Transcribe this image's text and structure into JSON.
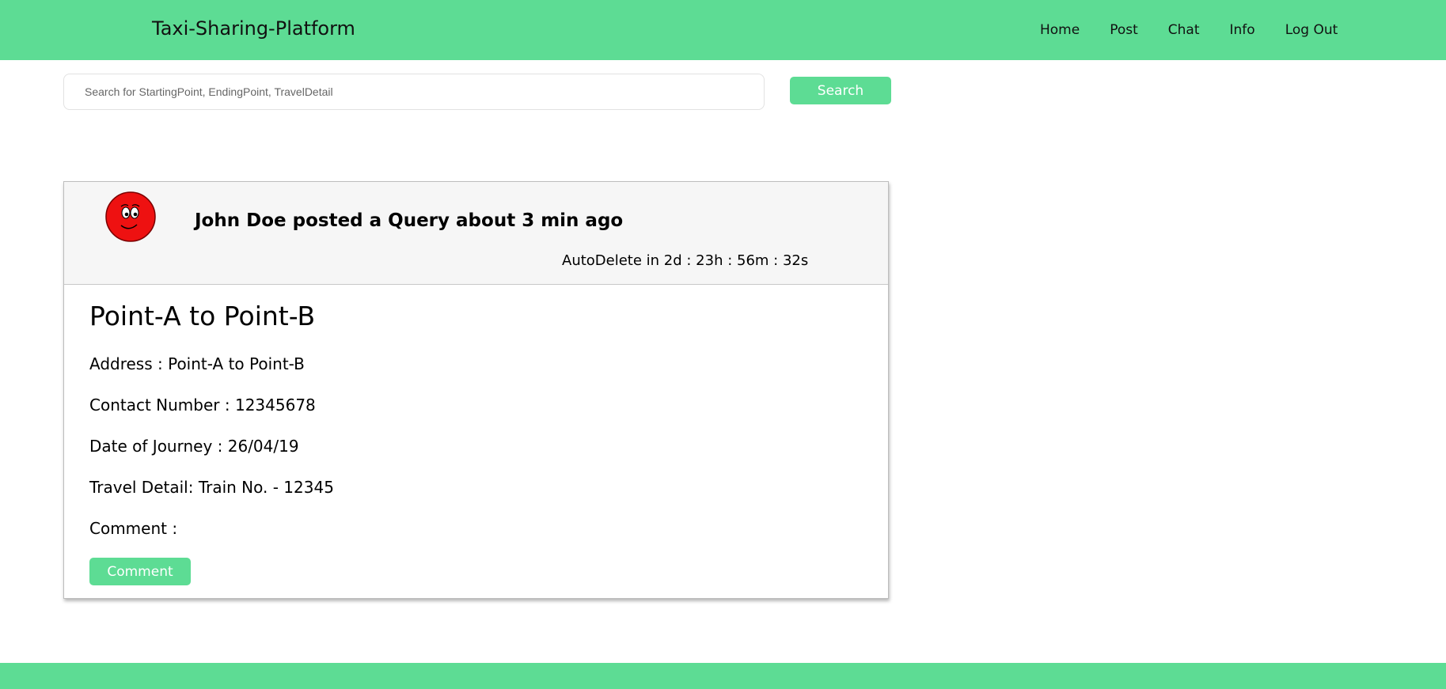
{
  "navbar": {
    "brand": "Taxi-Sharing-Platform",
    "links": [
      "Home",
      "Post",
      "Chat",
      "Info",
      "Log Out"
    ],
    "color": "#5ddc94"
  },
  "search": {
    "placeholder": "Search for StartingPoint, EndingPoint, TravelDetail",
    "value": "",
    "button_label": "Search"
  },
  "post": {
    "avatar_icon": "smiley-face-icon",
    "header_text": "John Doe posted a Query about 3 min ago",
    "autodelete_text": "AutoDelete in 2d : 23h : 56m : 32s",
    "title": "Point-A to Point-B",
    "address": "Address : Point-A to Point-B",
    "contact": "Contact Number : 12345678",
    "date": "Date of Journey : 26/04/19",
    "travel_detail": "Travel Detail: Train No. - 12345",
    "comment_label": "Comment :",
    "comment_button": "Comment"
  }
}
